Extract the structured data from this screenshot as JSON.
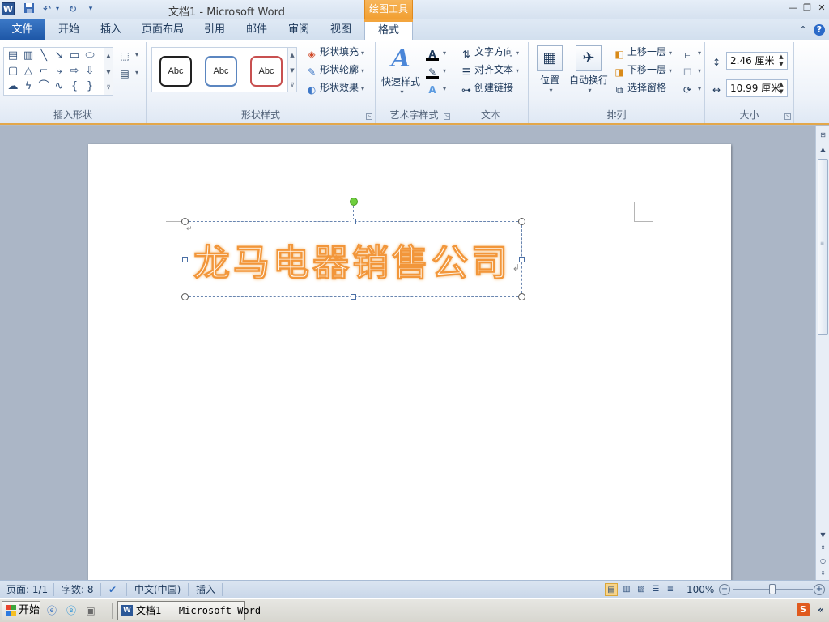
{
  "window": {
    "title": "文档1  -  Microsoft Word",
    "context_tab_group": "绘图工具"
  },
  "tabs": {
    "file": "文件",
    "items": [
      "开始",
      "插入",
      "页面布局",
      "引用",
      "邮件",
      "审阅",
      "视图",
      "格式"
    ],
    "active": "格式"
  },
  "ribbon": {
    "insert_shapes": {
      "label": "插入形状"
    },
    "shape_styles": {
      "label": "形状样式",
      "swatches": [
        "Abc",
        "Abc",
        "Abc"
      ],
      "fill": "形状填充",
      "outline": "形状轮廓",
      "effects": "形状效果"
    },
    "wordart_styles": {
      "label": "艺术字样式",
      "quick_styles": "快速样式"
    },
    "text": {
      "label": "文本",
      "direction": "文字方向",
      "align": "对齐文本",
      "link": "创建链接"
    },
    "arrange": {
      "label": "排列",
      "position": "位置",
      "wrap": "自动换行",
      "bring_forward": "上移一层",
      "send_backward": "下移一层",
      "selection_pane": "选择窗格"
    },
    "size": {
      "label": "大小",
      "height": "2.46 厘米",
      "width": "10.99 厘米"
    }
  },
  "document": {
    "wordart_text": "龙马电器销售公司"
  },
  "statusbar": {
    "page": "页面: 1/1",
    "words": "字数: 8",
    "language": "中文(中国)",
    "mode": "插入",
    "zoom": "100%"
  },
  "taskbar": {
    "start": "开始",
    "word_task": "文档1 - Microsoft Word"
  },
  "colors": {
    "accent_file_tab": "#2b5da8",
    "context_tab": "#f19f31",
    "wordart_outline": "#f2963a",
    "style_swatch_borders": [
      "#222222",
      "#5b86c0",
      "#c85050"
    ]
  }
}
